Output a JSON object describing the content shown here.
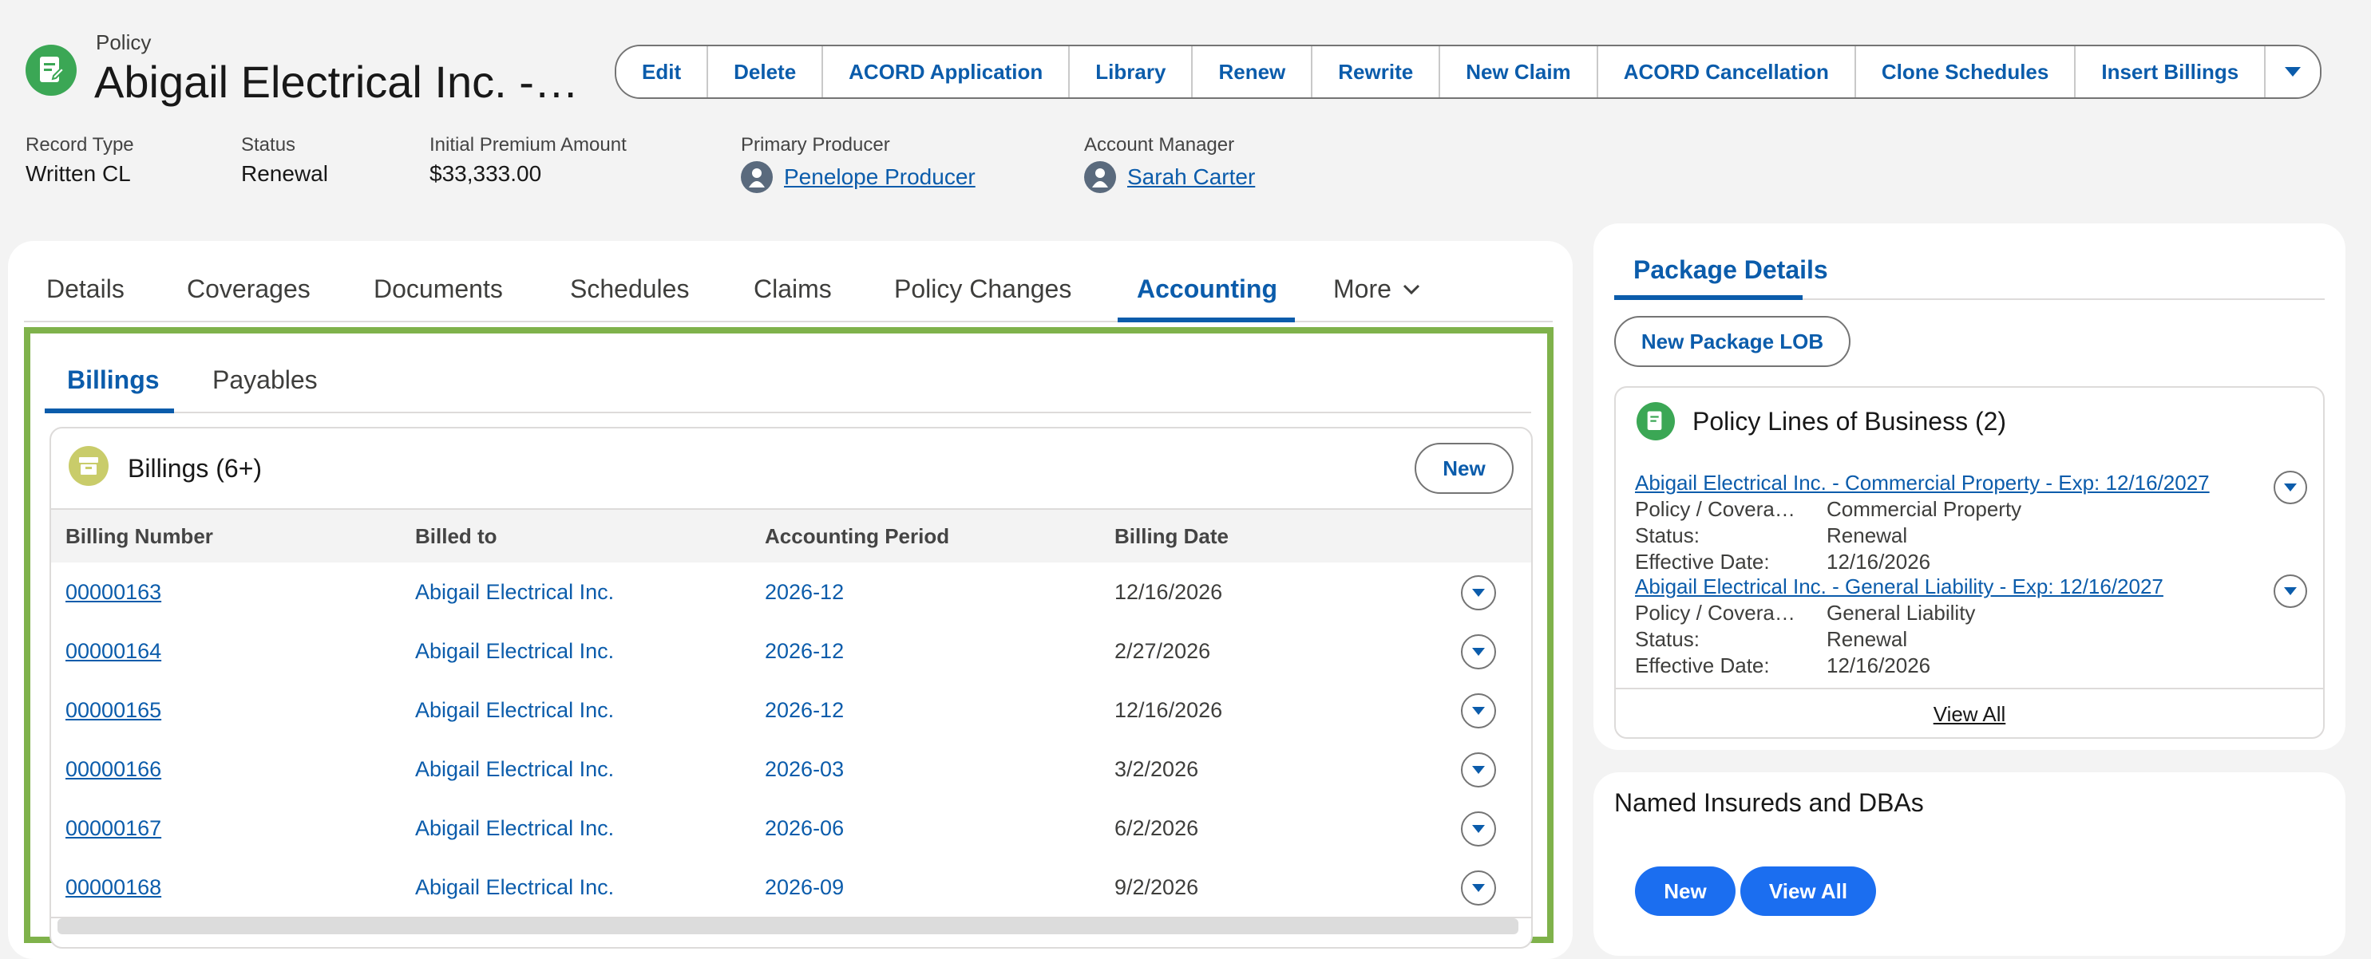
{
  "header": {
    "object_type": "Policy",
    "title": "Abigail Electrical Inc. -…",
    "icon": "policy-document-icon",
    "actions": [
      "Edit",
      "Delete",
      "ACORD Application",
      "Library",
      "Renew",
      "Rewrite",
      "New Claim",
      "ACORD Cancellation",
      "Clone Schedules",
      "Insert Billings"
    ]
  },
  "highlights": {
    "record_type": {
      "label": "Record Type",
      "value": "Written CL"
    },
    "status": {
      "label": "Status",
      "value": "Renewal"
    },
    "initial_premium": {
      "label": "Initial Premium Amount",
      "value": "$33,333.00"
    },
    "primary_producer": {
      "label": "Primary Producer",
      "value": "Penelope Producer"
    },
    "account_manager": {
      "label": "Account Manager",
      "value": "Sarah Carter"
    }
  },
  "tabs": [
    "Details",
    "Coverages",
    "Documents",
    "Schedules",
    "Claims",
    "Policy Changes",
    "Accounting",
    "More"
  ],
  "active_tab": "Accounting",
  "subtabs": [
    "Billings",
    "Payables"
  ],
  "billings": {
    "title": "Billings (6+)",
    "new_label": "New",
    "columns": [
      "Billing Number",
      "Billed to",
      "Accounting Period",
      "Billing Date"
    ],
    "rows": [
      [
        "00000163",
        "Abigail Electrical Inc.",
        "2026-12",
        "12/16/2026"
      ],
      [
        "00000164",
        "Abigail Electrical Inc.",
        "2026-12",
        "2/27/2026"
      ],
      [
        "00000165",
        "Abigail Electrical Inc.",
        "2026-12",
        "12/16/2026"
      ],
      [
        "00000166",
        "Abigail Electrical Inc.",
        "2026-03",
        "3/2/2026"
      ],
      [
        "00000167",
        "Abigail Electrical Inc.",
        "2026-06",
        "6/2/2026"
      ],
      [
        "00000168",
        "Abigail Electrical Inc.",
        "2026-09",
        "9/2/2026"
      ]
    ]
  },
  "package": {
    "tab": "Package Details",
    "new_lob": "New Package LOB",
    "lob_title": "Policy Lines of Business (2)",
    "items": [
      {
        "link": "Abigail Electrical Inc. - Commercial Property - Exp: 12/16/2027",
        "coverage_label": "Policy / Covera…",
        "coverage": "Commercial Property",
        "status_label": "Status:",
        "status": "Renewal",
        "eff_label": "Effective Date:",
        "eff": "12/16/2026"
      },
      {
        "link": "Abigail Electrical Inc. - General Liability - Exp: 12/16/2027",
        "coverage_label": "Policy / Covera…",
        "coverage": "General Liability",
        "status_label": "Status:",
        "status": "Renewal",
        "eff_label": "Effective Date:",
        "eff": "12/16/2026"
      }
    ],
    "view_all": "View All"
  },
  "insureds": {
    "title": "Named Insureds and DBAs",
    "new_label": "New",
    "view_all": "View All"
  },
  "colors": {
    "brand": "#0b5cab",
    "highlight": "#7fb24b",
    "button": "#1b6ef0"
  }
}
